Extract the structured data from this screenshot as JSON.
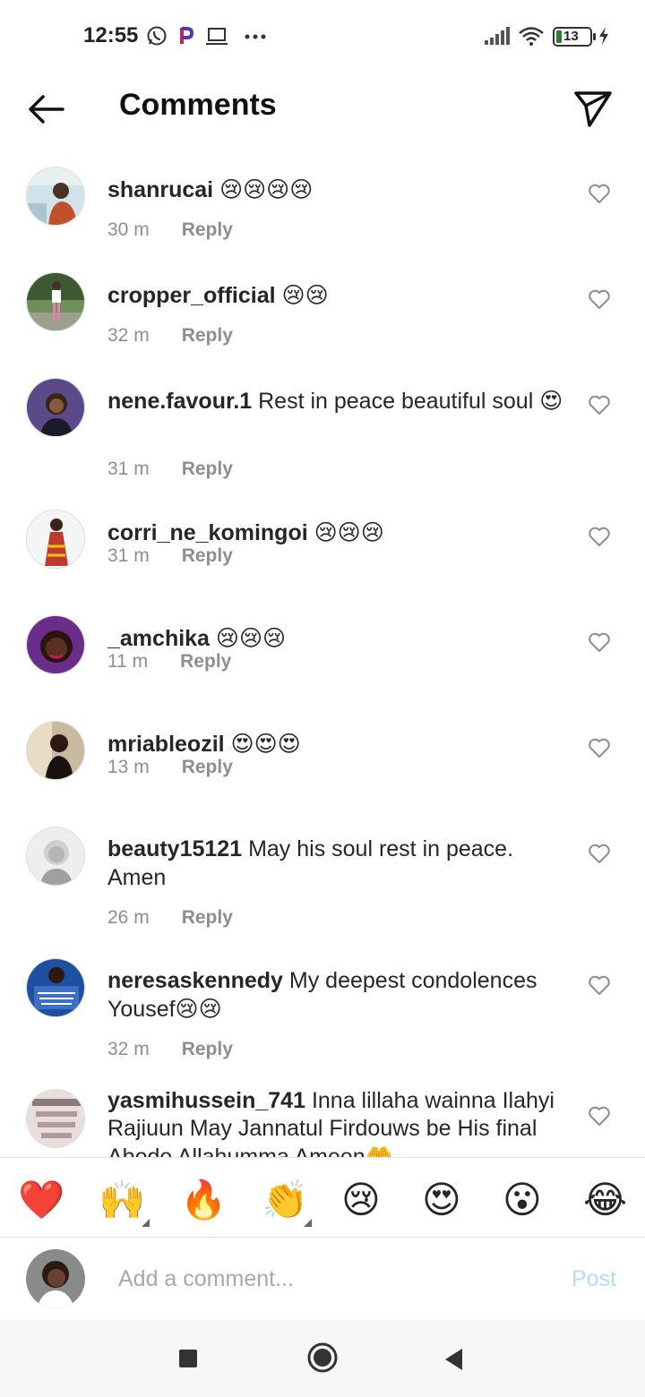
{
  "status_bar": {
    "time": "12:55",
    "battery": "13",
    "icons": [
      "whatsapp-icon",
      "p-app-icon",
      "laptop-icon",
      "more-dots-icon",
      "signal-icon",
      "wifi-icon",
      "battery-icon",
      "charging-icon"
    ]
  },
  "header": {
    "title": "Comments",
    "back_icon": "back-arrow-icon",
    "share_icon": "send-icon"
  },
  "comments": [
    {
      "username": "shanrucai",
      "text": "",
      "emoji": "😢😢😢😢",
      "time": "30 m",
      "reply": "Reply"
    },
    {
      "username": "cropper_official",
      "text": "",
      "emoji": "😢😢",
      "time": "32 m",
      "reply": "Reply"
    },
    {
      "username": "nene.favour.1",
      "text": "Rest in peace beautiful soul",
      "emoji": "😍",
      "time": "31 m",
      "reply": "Reply"
    },
    {
      "username": "corri_ne_komingoi",
      "text": "",
      "emoji": "😢😢😢",
      "time": "31 m",
      "reply": "Reply"
    },
    {
      "username": "_amchika",
      "text": "",
      "emoji": "😢😢😢",
      "time": "11 m",
      "reply": "Reply"
    },
    {
      "username": "mriableozil",
      "text": "",
      "emoji": "😍😍😍",
      "time": "13 m",
      "reply": "Reply"
    },
    {
      "username": "beauty15121",
      "text": "May his soul rest in peace. Amen",
      "emoji": "",
      "time": "26 m",
      "reply": "Reply"
    },
    {
      "username": "neresaskennedy",
      "text": "My deepest condolences Yousef",
      "emoji": "😢😢",
      "time": "32 m",
      "reply": "Reply"
    },
    {
      "username": "yasmihussein_741",
      "text": "Inna lillaha wainna Ilahyi Rajiuun May Jannatul Firdouws be His final Abode Allahumma Ameen",
      "emoji": "🤲",
      "time": "",
      "reply": ""
    }
  ],
  "reactions": [
    "❤️",
    "🙌",
    "🔥",
    "👏",
    "😢",
    "😍",
    "😮",
    "😂"
  ],
  "composer": {
    "placeholder": "Add a comment...",
    "post_label": "Post"
  },
  "colors": {
    "text": "#262626",
    "meta": "#8e8e8e",
    "post_disabled": "#b3dbff",
    "divider": "#e6e6e6"
  }
}
